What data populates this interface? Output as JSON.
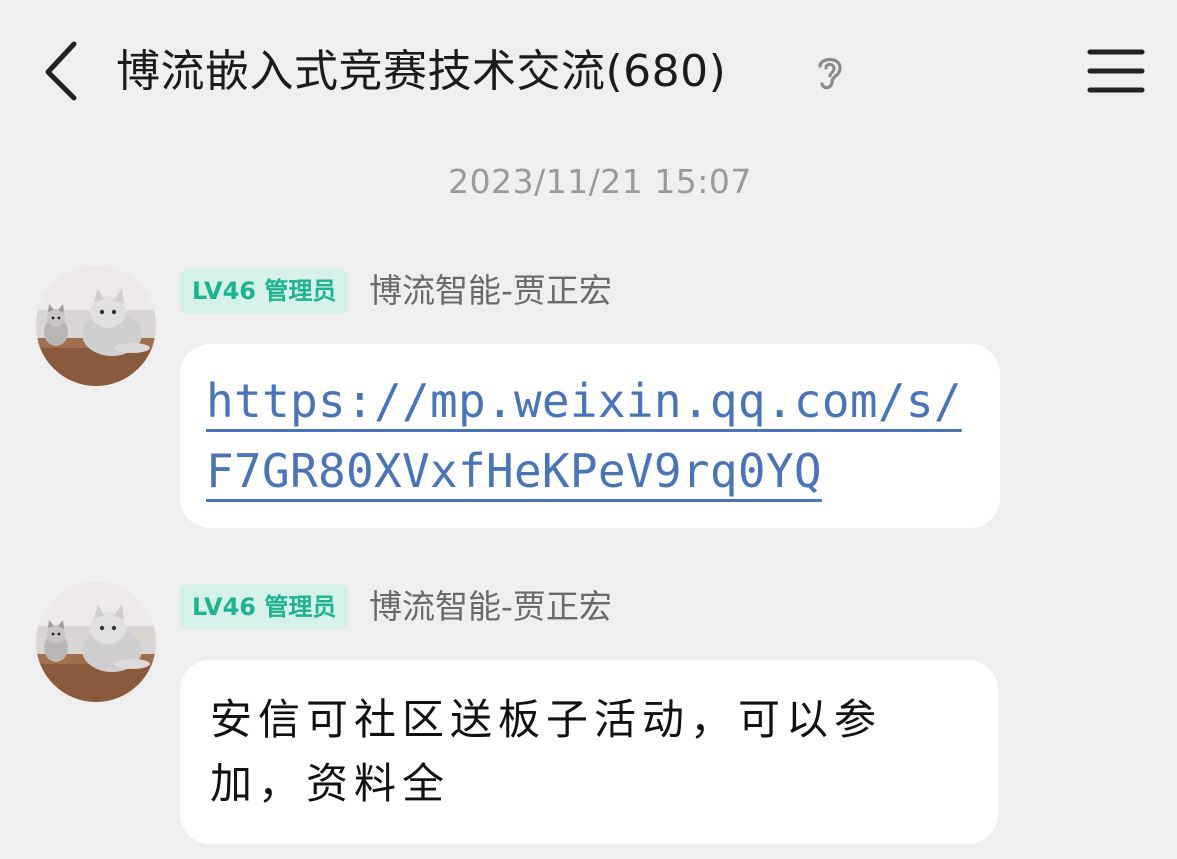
{
  "header": {
    "back_icon": "chevron-left-icon",
    "title": "博流嵌入式竞赛技术交流(680)",
    "ear_icon": "ear-icon",
    "menu_icon": "hamburger-menu-icon"
  },
  "timestamp": "2023/11/21 15:07",
  "messages": [
    {
      "avatar_icon": "cat-avatar",
      "badge": "LV46 管理员",
      "sender": "博流智能-贾正宏",
      "text": "https://mp.weixin.qq.com/s/F7GR80XVxfHeKPeV9rq0YQ",
      "is_link": true
    },
    {
      "avatar_icon": "cat-avatar",
      "badge": "LV46 管理员",
      "sender": "博流智能-贾正宏",
      "text": "安信可社区送板子活动，可以参加，资料全",
      "is_link": false
    }
  ],
  "colors": {
    "background": "#efefef",
    "badge_bg": "#d6f1ea",
    "badge_text": "#1eb38f",
    "link": "#4a74b8",
    "timestamp": "#9a9a9a"
  }
}
